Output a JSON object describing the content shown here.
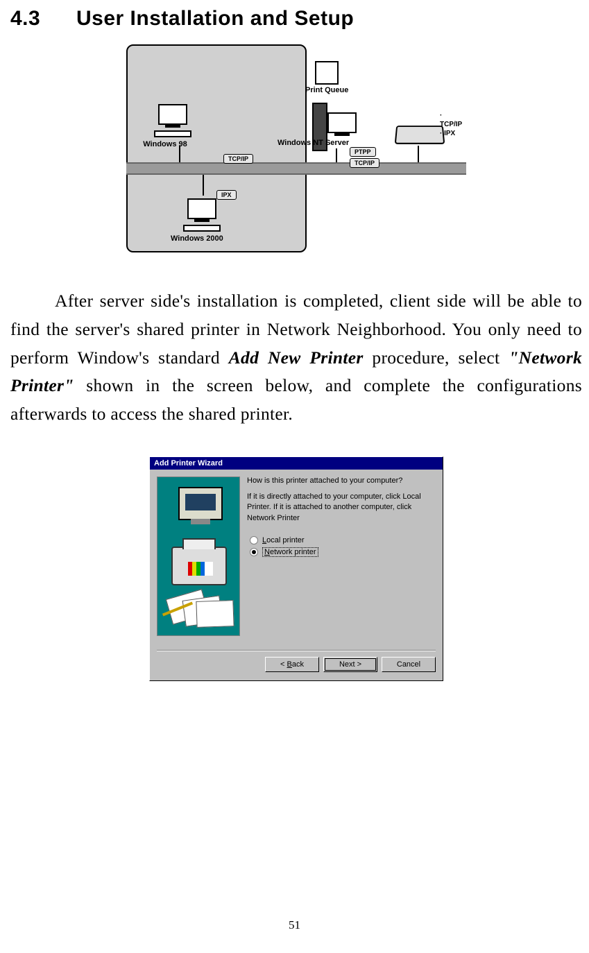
{
  "section": {
    "number": "4.3",
    "title": "User Installation and Setup"
  },
  "diagram": {
    "print_queue_label": "Print Queue",
    "win98": "Windows 98",
    "winnt": "Windows NT Server",
    "win2000": "Windows 2000",
    "tcpip": "TCP/IP",
    "ipx": "IPX",
    "ptpp": "PTPP",
    "proto1": "· TCP/IP",
    "proto2": "· IPX"
  },
  "paragraph": {
    "p1": "After server side's installation is completed, client side will be able to find the server's shared printer in Network Neighborhood. You only need to perform Window's standard ",
    "add_new_printer": "Add New Printer",
    "p2": " procedure, select ",
    "network_printer_quoted": "\"Network Printer\"",
    "p3": " shown in the screen below, and complete the configurations afterwards to access the shared printer."
  },
  "wizard": {
    "title": "Add Printer Wizard",
    "question": "How is this printer attached to your computer?",
    "hint": "If it is directly attached to your computer, click Local Printer. If it is attached to another computer, click Network Printer",
    "option_local_pre": "L",
    "option_local_rest": "ocal printer",
    "option_network_pre": "N",
    "option_network_rest": "etwork printer",
    "back_pre": "< ",
    "back_u": "B",
    "back_rest": "ack",
    "next": "Next >",
    "cancel": "Cancel"
  },
  "page_number": "51"
}
